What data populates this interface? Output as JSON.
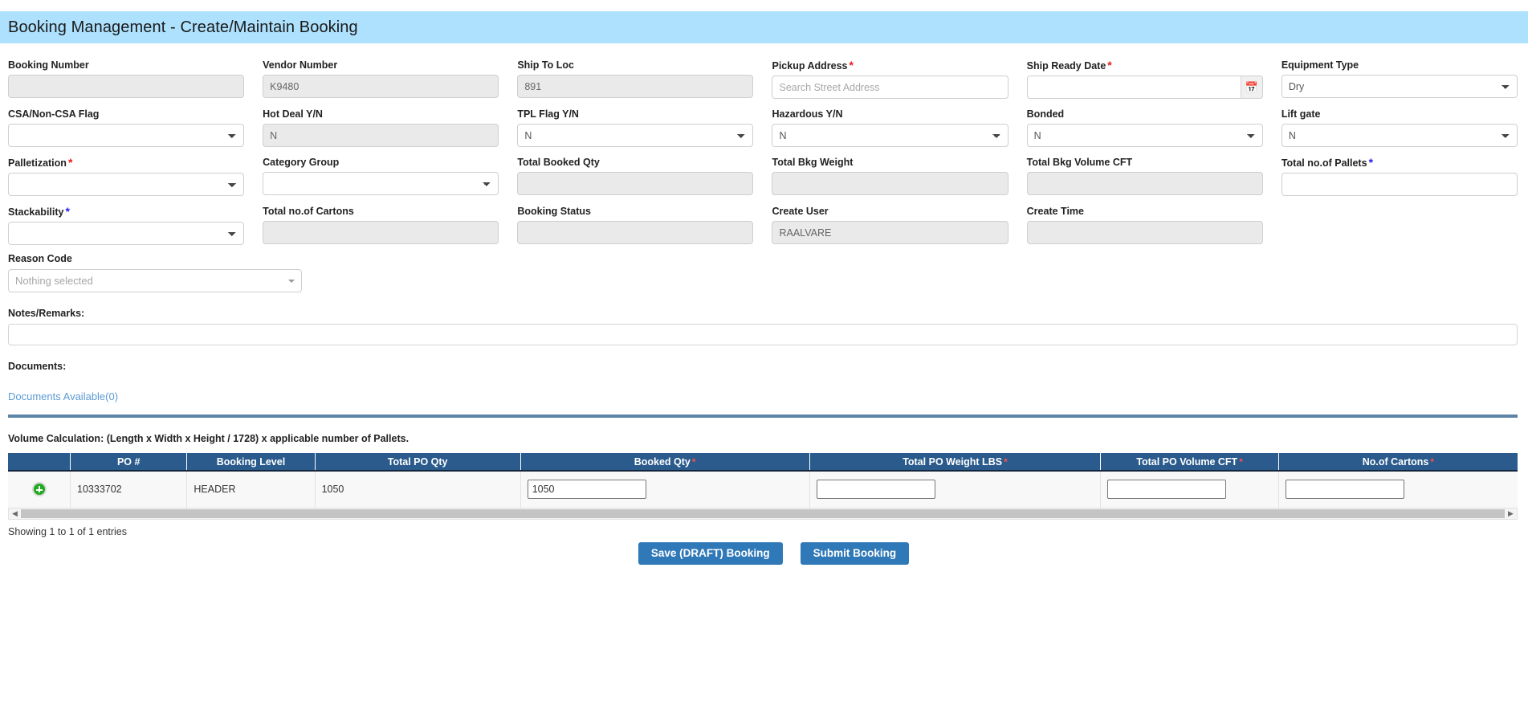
{
  "header": {
    "title": "Booking Management - Create/Maintain Booking",
    "background": "#ade1fd"
  },
  "colors": {
    "accent": "#3079b8",
    "table_header": "#2a5b8c",
    "divider": "#5b84a8",
    "required_red": "#e81b1b",
    "required_blue": "#2020ee",
    "link": "#5b9bd5"
  },
  "form": {
    "fields": [
      {
        "label": "Booking Number",
        "required": null,
        "type": "text",
        "value": "",
        "placeholder": "",
        "readonly": true
      },
      {
        "label": "Vendor Number",
        "required": null,
        "type": "text",
        "value": "K9480",
        "placeholder": "",
        "readonly": true
      },
      {
        "label": "Ship To Loc",
        "required": null,
        "type": "text",
        "value": "891",
        "placeholder": "",
        "readonly": true
      },
      {
        "label": "Pickup Address",
        "required": "red",
        "type": "text",
        "value": "",
        "placeholder": "Search Street Address",
        "readonly": false
      },
      {
        "label": "Ship Ready Date",
        "required": "red",
        "type": "date",
        "value": "",
        "placeholder": "",
        "readonly": false,
        "icon": "calendar-icon"
      },
      {
        "label": "Equipment Type",
        "required": null,
        "type": "select",
        "value": "Dry",
        "readonly": false,
        "options": [
          "Dry"
        ]
      },
      {
        "label": "CSA/Non-CSA Flag",
        "required": null,
        "type": "select",
        "value": "",
        "readonly": false,
        "options": [
          ""
        ]
      },
      {
        "label": "Hot Deal Y/N",
        "required": null,
        "type": "select",
        "value": "N",
        "readonly": true,
        "options": [
          "N",
          "Y"
        ]
      },
      {
        "label": "TPL Flag Y/N",
        "required": null,
        "type": "select",
        "value": "N",
        "readonly": false,
        "options": [
          "N",
          "Y"
        ]
      },
      {
        "label": "Hazardous Y/N",
        "required": null,
        "type": "select",
        "value": "N",
        "readonly": false,
        "options": [
          "N",
          "Y"
        ]
      },
      {
        "label": "Bonded",
        "required": null,
        "type": "select",
        "value": "N",
        "readonly": false,
        "options": [
          "N",
          "Y"
        ]
      },
      {
        "label": "Lift gate",
        "required": null,
        "type": "select",
        "value": "N",
        "readonly": false,
        "options": [
          "N",
          "Y"
        ]
      },
      {
        "label": "Palletization",
        "required": "red",
        "type": "select",
        "value": "",
        "readonly": false,
        "options": [
          ""
        ]
      },
      {
        "label": "Category Group",
        "required": null,
        "type": "select",
        "value": "",
        "readonly": false,
        "options": [
          ""
        ]
      },
      {
        "label": "Total Booked Qty",
        "required": null,
        "type": "text",
        "value": "",
        "placeholder": "",
        "readonly": true
      },
      {
        "label": "Total Bkg Weight",
        "required": null,
        "type": "text",
        "value": "",
        "placeholder": "",
        "readonly": true
      },
      {
        "label": "Total Bkg Volume CFT",
        "required": null,
        "type": "text",
        "value": "",
        "placeholder": "",
        "readonly": true
      },
      {
        "label": "Total no.of Pallets",
        "required": "blue",
        "type": "text",
        "value": "",
        "placeholder": "",
        "readonly": false
      },
      {
        "label": "Stackability",
        "required": "blue",
        "type": "select",
        "value": "",
        "readonly": false,
        "options": [
          ""
        ]
      },
      {
        "label": "Total no.of Cartons",
        "required": null,
        "type": "text",
        "value": "",
        "placeholder": "",
        "readonly": true
      },
      {
        "label": "Booking Status",
        "required": null,
        "type": "text",
        "value": "",
        "placeholder": "",
        "readonly": true
      },
      {
        "label": "Create User",
        "required": null,
        "type": "text",
        "value": "RAALVARE",
        "placeholder": "",
        "readonly": true
      },
      {
        "label": "Create Time",
        "required": null,
        "type": "text",
        "value": "",
        "placeholder": "",
        "readonly": true
      },
      {
        "label": "",
        "type": "spacer"
      }
    ],
    "reason_code": {
      "label": "Reason Code",
      "placeholder": "Nothing selected",
      "value": "",
      "caret_icon": "chevron-down-icon"
    },
    "notes": {
      "label": "Notes/Remarks:",
      "value": "",
      "placeholder": ""
    },
    "documents": {
      "label": "Documents:",
      "link_text": "Documents Available(0)"
    }
  },
  "volume_note": "Volume Calculation: (Length x Width x Height / 1728) x applicable number of Pallets.",
  "table": {
    "columns": [
      {
        "label": "",
        "required": false
      },
      {
        "label": "PO #",
        "required": false
      },
      {
        "label": "Booking Level",
        "required": false
      },
      {
        "label": "Total PO Qty",
        "required": false
      },
      {
        "label": "Booked Qty",
        "required": true
      },
      {
        "label": "Total PO Weight LBS",
        "required": true
      },
      {
        "label": "Total PO Volume CFT",
        "required": true
      },
      {
        "label": "No.of Cartons",
        "required": true
      }
    ],
    "rows": [
      {
        "expand_icon": "plus-circle-icon",
        "po_number": "10333702",
        "booking_level": "HEADER",
        "total_po_qty": "1050",
        "booked_qty": "1050",
        "total_po_weight_lbs": "",
        "total_po_volume_cft": "",
        "no_of_cartons": ""
      }
    ],
    "entries_text": "Showing 1 to 1 of 1 entries",
    "scroll_left_icon": "chevron-left-icon",
    "scroll_right_icon": "chevron-right-icon"
  },
  "buttons": {
    "save_draft": "Save (DRAFT) Booking",
    "submit": "Submit Booking"
  }
}
